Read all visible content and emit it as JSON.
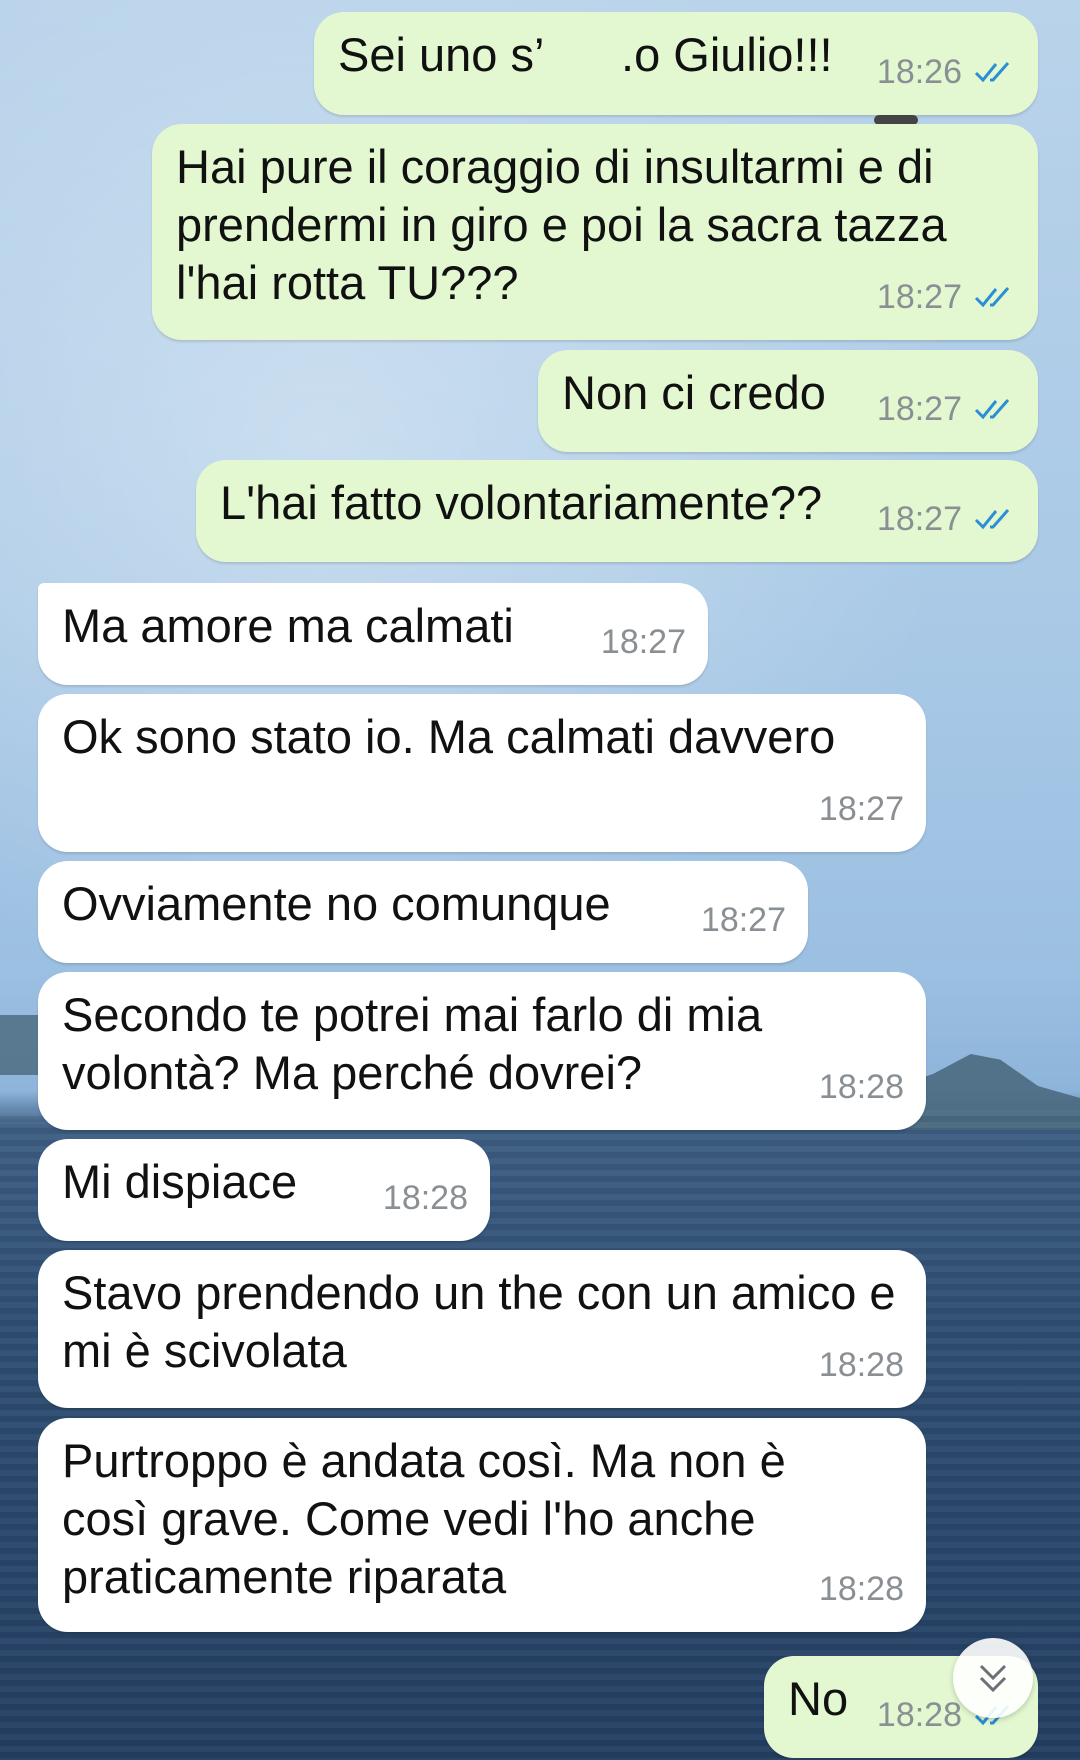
{
  "colors": {
    "outgoing_bubble": "#e3f8d0",
    "incoming_bubble": "#ffffff",
    "read_ticks": "#2b8fd6",
    "timestamp": "#8a8f94"
  },
  "messages": [
    {
      "id": "m1",
      "dir": "out",
      "text": "Sei uno s’      .o Giulio!!!",
      "time": "18:26",
      "ticks": "read-double-check-icon"
    },
    {
      "id": "m2",
      "dir": "out",
      "text": "Hai pure il coraggio di insultarmi e di prendermi in giro e poi la sacra tazza l'hai rotta TU???",
      "time": "18:27",
      "ticks": "read-double-check-icon"
    },
    {
      "id": "m3",
      "dir": "out",
      "text": "Non ci credo",
      "time": "18:27",
      "ticks": "read-double-check-icon"
    },
    {
      "id": "m4",
      "dir": "out",
      "text": "L'hai fatto volontariamente??",
      "time": "18:27",
      "ticks": "read-double-check-icon"
    },
    {
      "id": "m5",
      "dir": "in",
      "text": "Ma amore ma calmati",
      "time": "18:27"
    },
    {
      "id": "m6",
      "dir": "in",
      "text": "Ok sono stato io. Ma calmati davvero",
      "time": "18:27"
    },
    {
      "id": "m7",
      "dir": "in",
      "text": "Ovviamente no comunque",
      "time": "18:27"
    },
    {
      "id": "m8",
      "dir": "in",
      "text": "Secondo te potrei mai farlo di mia volontà? Ma perché dovrei?",
      "time": "18:28"
    },
    {
      "id": "m9",
      "dir": "in",
      "text": "Mi dispiace",
      "time": "18:28"
    },
    {
      "id": "m10",
      "dir": "in",
      "text": "Stavo prendendo un the con un amico e mi è scivolata",
      "time": "18:28"
    },
    {
      "id": "m11",
      "dir": "in",
      "text": "Purtroppo è andata così. Ma non è così grave. Come vedi l'ho anche praticamente riparata",
      "time": "18:28"
    },
    {
      "id": "m12",
      "dir": "out",
      "text": "No",
      "time": "18:28",
      "ticks": "read-double-check-icon"
    }
  ],
  "scroll_button": {
    "icon": "double-chevron-down-icon"
  }
}
